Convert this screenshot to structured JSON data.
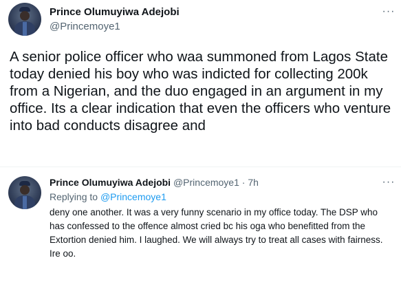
{
  "main_tweet": {
    "author_name": "Prince Olumuyiwa Adejobi",
    "author_handle": "@Princemoye1",
    "more_icon": "more-horizontal-icon",
    "text": "A senior police officer who waa summoned from Lagos State today denied his boy who was indicted  for collecting 200k from a Nigerian, and the duo engaged in an argument in my office. Its a clear indication that even the officers who venture into bad conducts disagree and"
  },
  "reply_tweet": {
    "author_name": "Prince Olumuyiwa Adejobi",
    "author_handle": "@Princemoye1",
    "separator": " · ",
    "time": "7h",
    "replying_prefix": "Replying to ",
    "replying_to": "@Princemoye1",
    "more_icon": "more-horizontal-icon",
    "text": "deny one another.  It was a very funny scenario in my office today. The DSP who has confessed to the offence almost cried bc his oga who benefitted from the Extortion denied him. I laughed. We will always try to treat all cases with fairness. Ire oo."
  },
  "colors": {
    "text": "#0f1419",
    "secondary": "#536471",
    "link": "#1d9bf0",
    "divider": "#eff3f4"
  }
}
